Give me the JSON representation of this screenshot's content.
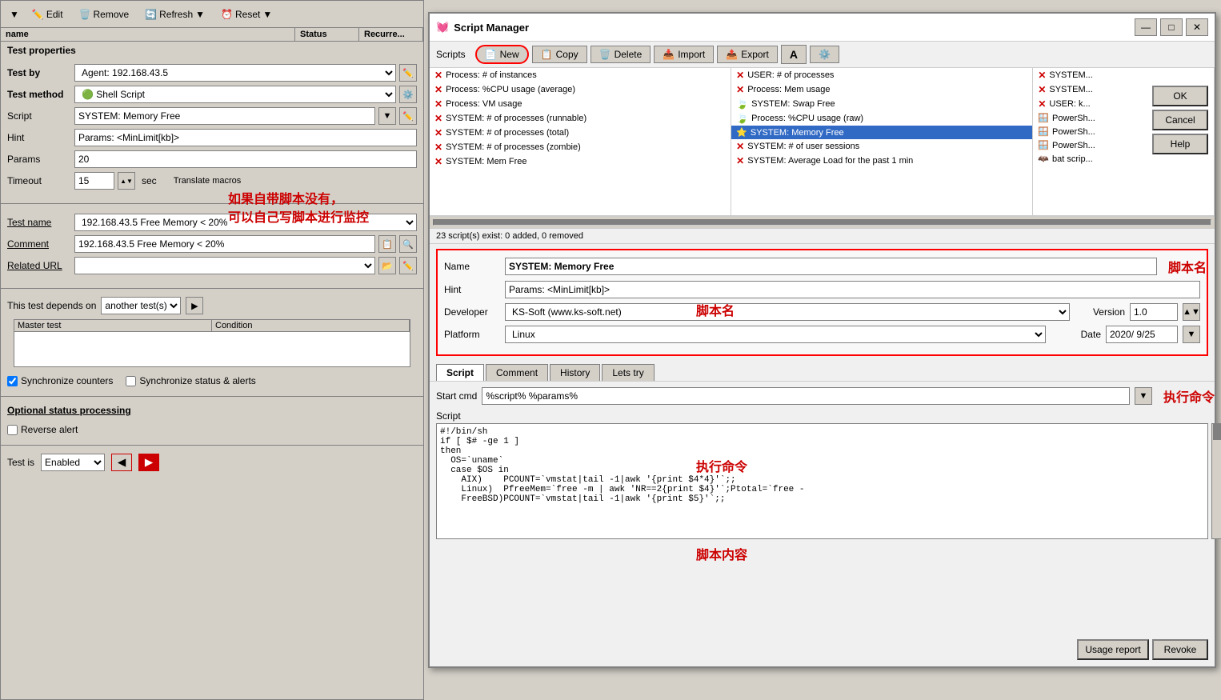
{
  "left_panel": {
    "toolbar": {
      "edit_label": "Edit",
      "remove_label": "Remove",
      "refresh_label": "Refresh",
      "reset_label": "Reset"
    },
    "table_headers": [
      "name",
      "Status",
      "Recurre..."
    ],
    "section_title": "Test properties",
    "form": {
      "test_by_label": "Test by",
      "test_by_value": "Agent: 192.168.43.5",
      "test_method_label": "Test method",
      "test_method_value": "Shell Script",
      "script_label": "Script",
      "script_value": "SYSTEM: Memory Free",
      "hint_label": "Hint",
      "hint_value": "Params: <MinLimit[kb]>",
      "params_label": "Params",
      "params_value": "20",
      "timeout_label": "Timeout",
      "timeout_value": "15",
      "timeout_unit": "sec",
      "translate_macros": "Translate macros"
    },
    "test_name_label": "Test name",
    "test_name_value": "192.168.43.5 Free Memory < 20%",
    "comment_label": "Comment",
    "comment_value": "192.168.43.5 Free Memory < 20%",
    "related_url_label": "Related URL",
    "depends_label": "This test depends on",
    "depends_value": "another test(s)",
    "master_test_header": "Master test",
    "condition_header": "Condition",
    "sync_counters": "Synchronize counters",
    "sync_status": "Synchronize status & alerts",
    "optional_label": "Optional status processing",
    "reverse_alert": "Reverse alert",
    "test_is_label": "Test is",
    "test_is_value": "Enabled"
  },
  "script_manager": {
    "title": "Script Manager",
    "toolbar": {
      "scripts_label": "Scripts",
      "new_label": "New",
      "copy_label": "Copy",
      "delete_label": "Delete",
      "import_label": "Import",
      "export_label": "Export"
    },
    "scripts_col1": [
      {
        "name": "Process: # of instances",
        "icon": "x"
      },
      {
        "name": "Process: %CPU usage (average)",
        "icon": "x"
      },
      {
        "name": "Process: VM usage",
        "icon": "x"
      },
      {
        "name": "SYSTEM: # of processes (runnable)",
        "icon": "x"
      },
      {
        "name": "SYSTEM: # of processes (total)",
        "icon": "x"
      },
      {
        "name": "SYSTEM: # of processes (zombie)",
        "icon": "x"
      },
      {
        "name": "SYSTEM: Mem Free",
        "icon": "x"
      }
    ],
    "scripts_col2": [
      {
        "name": "USER: # of processes",
        "icon": "x"
      },
      {
        "name": "Process: Mem usage",
        "icon": "x"
      },
      {
        "name": "SYSTEM: Swap Free",
        "icon": "leaf"
      },
      {
        "name": "Process: %CPU usage (raw)",
        "icon": "leaf"
      },
      {
        "name": "SYSTEM: Memory Free",
        "icon": "star",
        "selected": true
      },
      {
        "name": "SYSTEM: # of user sessions",
        "icon": "x"
      },
      {
        "name": "SYSTEM: Average Load for the past 1 min",
        "icon": "x"
      }
    ],
    "scripts_col3": [
      {
        "name": "SYSTEM...",
        "icon": "x"
      },
      {
        "name": "SYSTEM...",
        "icon": "x"
      },
      {
        "name": "USER: k...",
        "icon": "x"
      },
      {
        "name": "PowerSh...",
        "icon": "win"
      },
      {
        "name": "PowerSh...",
        "icon": "win"
      },
      {
        "name": "PowerSh...",
        "icon": "win"
      },
      {
        "name": "bat scrip...",
        "icon": "bat"
      }
    ],
    "status_text": "23 script(s) exist: 0 added, 0 removed",
    "detail": {
      "name_label": "Name",
      "name_value": "SYSTEM: Memory Free",
      "hint_label": "Hint",
      "hint_value": "Params: <MinLimit[kb]>",
      "developer_label": "Developer",
      "developer_value": "KS-Soft (www.ks-soft.net)",
      "version_label": "Version",
      "version_value": "1.0",
      "platform_label": "Platform",
      "platform_value": "Linux",
      "date_label": "Date",
      "date_value": "2020/ 9/25"
    },
    "tabs": [
      "Script",
      "Comment",
      "History",
      "Lets try"
    ],
    "active_tab": "Script",
    "start_cmd_label": "Start cmd",
    "start_cmd_value": "%script% %params%",
    "script_label": "Script",
    "script_content": "#!/bin/sh\nif [ $# -ge 1 ]\nthen\n  OS=`uname`\n  case $OS in\n    AIX)    PCOUNT=`vmstat|tail -1|awk '{print $4*4}'`;;\n    Linux)  PfreeMem=`free -m | awk 'NR==2{print $4}'`;Ptotal=`free -\n    FreeBSD)PCOUNT=`vmstat|tail -1|awk '{print $5}'`;;",
    "action_buttons": {
      "ok": "OK",
      "cancel": "Cancel",
      "help": "Help",
      "usage_report": "Usage report",
      "revoke": "Revoke"
    }
  },
  "annotations": {
    "chinese_text1": "如果自带脚本没有，",
    "chinese_text2": "可以自己写脚本进行监控",
    "script_name_label": "脚本名",
    "execute_cmd_label": "执行命令",
    "script_content_label": "脚本内容"
  }
}
